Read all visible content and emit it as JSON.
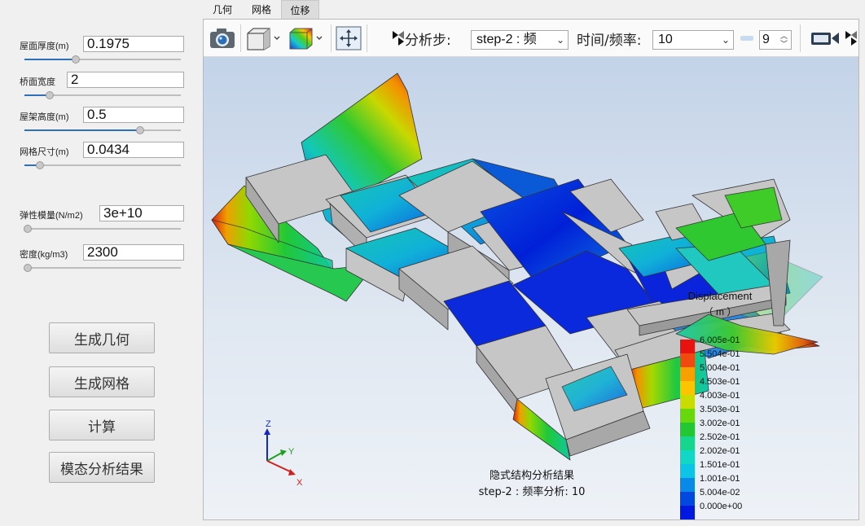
{
  "params": [
    {
      "label": "屋面厚度(m)",
      "value": "0.1975",
      "slider": 0.33
    },
    {
      "label": "桥面宽度",
      "value": "2",
      "slider": 0.16
    },
    {
      "label": "屋架高度(m)",
      "value": "0.5",
      "slider": 0.74
    },
    {
      "label": "网格尺寸(m)",
      "value": "0.0434",
      "slider": 0.1
    },
    {
      "label": "弹性模量(N/m2)",
      "value": "3e+10",
      "slider": 0.02
    },
    {
      "label": "密度(kg/m3)",
      "value": "2300",
      "slider": 0.02
    }
  ],
  "buttons": {
    "generate_geometry": "生成几何",
    "generate_mesh": "生成网格",
    "compute": "计算",
    "modal_results": "模态分析结果"
  },
  "tabs": [
    {
      "label": "几何",
      "active": false
    },
    {
      "label": "网格",
      "active": false
    },
    {
      "label": "位移",
      "active": true
    }
  ],
  "toolbar": {
    "analysis_step_label": "分析步:",
    "analysis_step_value": "step-2 : 频",
    "time_freq_label": "时间/频率:",
    "time_freq_value": "10",
    "spin_value": "9",
    "camera_icon": "camera-icon",
    "view_cube_icon": "view-cube-icon",
    "color_map_icon": "color-map-icon",
    "fit_view_icon": "fit-view-icon",
    "video_icon": "video-camera-icon"
  },
  "viewer": {
    "caption_title": "隐式结构分析结果",
    "caption_sub": "step-2 : 频率分析: 10",
    "axes": {
      "x": "X",
      "y": "Y",
      "z": "Z"
    }
  },
  "legend": {
    "title": "Displacement",
    "unit": "（ m ）",
    "labels": [
      "6.005e-01",
      "5.504e-01",
      "5.004e-01",
      "4.503e-01",
      "4.003e-01",
      "3.503e-01",
      "3.002e-01",
      "2.502e-01",
      "2.002e-01",
      "1.501e-01",
      "1.001e-01",
      "5.004e-02",
      "0.000e+00"
    ],
    "colors": [
      "#e8120f",
      "#f04a10",
      "#f7a000",
      "#ffc400",
      "#c8dc00",
      "#66d80c",
      "#22c832",
      "#14d68c",
      "#10d8c4",
      "#0cc4e6",
      "#0a8ae8",
      "#0048e0",
      "#0018e0"
    ]
  },
  "colors": {
    "accent": "#2f6fb5",
    "gray_surface": "#c6c6c6"
  }
}
